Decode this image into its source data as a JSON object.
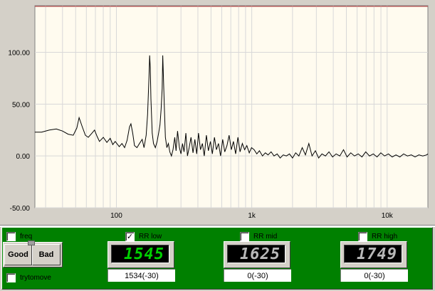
{
  "plot": {
    "y_ticks": [
      {
        "label": "100.00",
        "value": 100
      },
      {
        "label": "50.00",
        "value": 50
      },
      {
        "label": "0.00",
        "value": 0
      },
      {
        "label": "-50.00",
        "value": -50
      }
    ],
    "x_ticks": [
      {
        "label": "100",
        "value": 100
      },
      {
        "label": "1k",
        "value": 1000
      },
      {
        "label": "10k",
        "value": 10000
      }
    ],
    "ylim": [
      -50,
      145
    ],
    "xlim": [
      25,
      20000
    ],
    "colors": {
      "background": "#fffbef",
      "grid": "#d8d8d8",
      "line": "#000000",
      "top_marker": "#c04040"
    }
  },
  "chart_data": {
    "type": "line",
    "x_scale": "log",
    "ylim": [
      -50,
      145
    ],
    "xlim": [
      25,
      20000
    ],
    "series": [
      {
        "points": [
          [
            25,
            23
          ],
          [
            28,
            23
          ],
          [
            32,
            25
          ],
          [
            36,
            26
          ],
          [
            40,
            24
          ],
          [
            44,
            21
          ],
          [
            48,
            20
          ],
          [
            51,
            27
          ],
          [
            53,
            37
          ],
          [
            56,
            28
          ],
          [
            59,
            20
          ],
          [
            62,
            18
          ],
          [
            66,
            22
          ],
          [
            69,
            25
          ],
          [
            72,
            19
          ],
          [
            75,
            14
          ],
          [
            80,
            18
          ],
          [
            85,
            13
          ],
          [
            90,
            17
          ],
          [
            94,
            11
          ],
          [
            98,
            14
          ],
          [
            105,
            9
          ],
          [
            110,
            12
          ],
          [
            115,
            8
          ],
          [
            120,
            15
          ],
          [
            125,
            28
          ],
          [
            128,
            31
          ],
          [
            132,
            22
          ],
          [
            136,
            10
          ],
          [
            142,
            8
          ],
          [
            148,
            12
          ],
          [
            155,
            16
          ],
          [
            160,
            8
          ],
          [
            166,
            20
          ],
          [
            170,
            40
          ],
          [
            174,
            75
          ],
          [
            176,
            97
          ],
          [
            178,
            85
          ],
          [
            180,
            55
          ],
          [
            184,
            22
          ],
          [
            188,
            12
          ],
          [
            194,
            8
          ],
          [
            200,
            14
          ],
          [
            205,
            22
          ],
          [
            210,
            30
          ],
          [
            214,
            45
          ],
          [
            218,
            65
          ],
          [
            220,
            97
          ],
          [
            222,
            82
          ],
          [
            226,
            48
          ],
          [
            230,
            18
          ],
          [
            236,
            8
          ],
          [
            242,
            12
          ],
          [
            248,
            4
          ],
          [
            255,
            0
          ],
          [
            262,
            6
          ],
          [
            270,
            18
          ],
          [
            276,
            5
          ],
          [
            283,
            24
          ],
          [
            292,
            8
          ],
          [
            300,
            2
          ],
          [
            308,
            12
          ],
          [
            316,
            4
          ],
          [
            326,
            22
          ],
          [
            335,
            0
          ],
          [
            345,
            8
          ],
          [
            356,
            18
          ],
          [
            368,
            3
          ],
          [
            380,
            16
          ],
          [
            392,
            2
          ],
          [
            404,
            22
          ],
          [
            418,
            6
          ],
          [
            432,
            12
          ],
          [
            446,
            0
          ],
          [
            462,
            20
          ],
          [
            478,
            5
          ],
          [
            495,
            14
          ],
          [
            512,
            2
          ],
          [
            530,
            18
          ],
          [
            548,
            6
          ],
          [
            568,
            12
          ],
          [
            588,
            0
          ],
          [
            610,
            16
          ],
          [
            632,
            4
          ],
          [
            656,
            10
          ],
          [
            680,
            20
          ],
          [
            706,
            6
          ],
          [
            732,
            14
          ],
          [
            760,
            2
          ],
          [
            790,
            18
          ],
          [
            820,
            4
          ],
          [
            852,
            12
          ],
          [
            886,
            6
          ],
          [
            920,
            10
          ],
          [
            958,
            3
          ],
          [
            996,
            8
          ],
          [
            1040,
            6
          ],
          [
            1090,
            2
          ],
          [
            1140,
            5
          ],
          [
            1200,
            0
          ],
          [
            1260,
            3
          ],
          [
            1320,
            1
          ],
          [
            1390,
            4
          ],
          [
            1460,
            0
          ],
          [
            1540,
            2
          ],
          [
            1620,
            -2
          ],
          [
            1710,
            1
          ],
          [
            1800,
            0
          ],
          [
            1900,
            2
          ],
          [
            2000,
            -2
          ],
          [
            2110,
            3
          ],
          [
            2230,
            0
          ],
          [
            2360,
            8
          ],
          [
            2490,
            1
          ],
          [
            2640,
            12
          ],
          [
            2790,
            0
          ],
          [
            2950,
            5
          ],
          [
            3120,
            -2
          ],
          [
            3300,
            2
          ],
          [
            3500,
            0
          ],
          [
            3720,
            4
          ],
          [
            3950,
            -1
          ],
          [
            4200,
            2
          ],
          [
            4470,
            0
          ],
          [
            4760,
            6
          ],
          [
            5060,
            -1
          ],
          [
            5390,
            3
          ],
          [
            5740,
            0
          ],
          [
            6120,
            2
          ],
          [
            6520,
            -1
          ],
          [
            6950,
            4
          ],
          [
            7410,
            0
          ],
          [
            7900,
            2
          ],
          [
            8420,
            -1
          ],
          [
            8980,
            3
          ],
          [
            9580,
            0
          ],
          [
            10220,
            2
          ],
          [
            10900,
            -1
          ],
          [
            11630,
            1
          ],
          [
            12410,
            -1
          ],
          [
            13240,
            2
          ],
          [
            14130,
            0
          ],
          [
            15080,
            1
          ],
          [
            16090,
            -1
          ],
          [
            17170,
            1
          ],
          [
            18330,
            0
          ],
          [
            19560,
            1
          ],
          [
            20000,
            2
          ]
        ]
      }
    ]
  },
  "controls": {
    "freq": {
      "label": "freq",
      "checked": false,
      "mark": ""
    },
    "rr_low": {
      "label": "RR low",
      "checked": true,
      "mark": "✓",
      "display": "1545",
      "readout": "1534(-30)",
      "color": "#00d000"
    },
    "rr_mid": {
      "label": "RR mid",
      "checked": false,
      "mark": "",
      "display": "1625",
      "readout": "0(-30)",
      "color": "#b8b8b8"
    },
    "rr_high": {
      "label": "RR high",
      "checked": false,
      "mark": "",
      "display": "1749",
      "readout": "0(-30)",
      "color": "#b8b8b8"
    },
    "try_to_move": {
      "label": "trytomove",
      "checked": false,
      "mark": ""
    },
    "good_label": "Good",
    "bad_label": "Bad",
    "panel_color": "#008000"
  }
}
